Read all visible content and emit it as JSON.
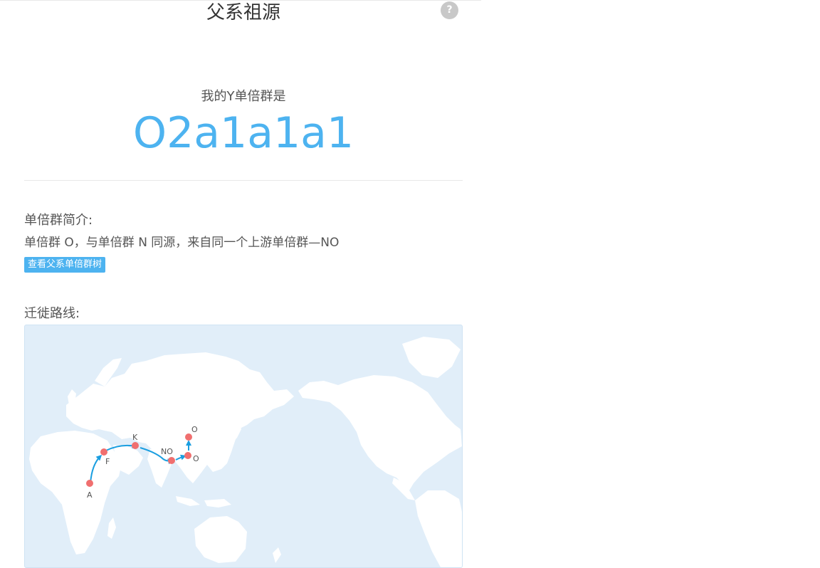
{
  "header": {
    "title": "父系祖源",
    "help_icon": "?"
  },
  "haplogroup": {
    "intro": "我的Y单倍群是",
    "value": "O2a1a1a1"
  },
  "summary": {
    "heading": "单倍群简介:",
    "text": "单倍群 O，与单倍群 N 同源，来自同一个上游单倍群—NO",
    "tree_button_label": "查看父系单倍群树"
  },
  "migration": {
    "heading": "迁徙路线:",
    "nodes": [
      "A",
      "F",
      "K",
      "NO",
      "O",
      "O"
    ]
  },
  "colors": {
    "accent": "#4db3f0",
    "map_ocean": "#e1eef9",
    "land": "#ffffff",
    "node": "#f06f6f",
    "route": "#1a9ee0"
  },
  "icons": {
    "help": "question-icon"
  }
}
